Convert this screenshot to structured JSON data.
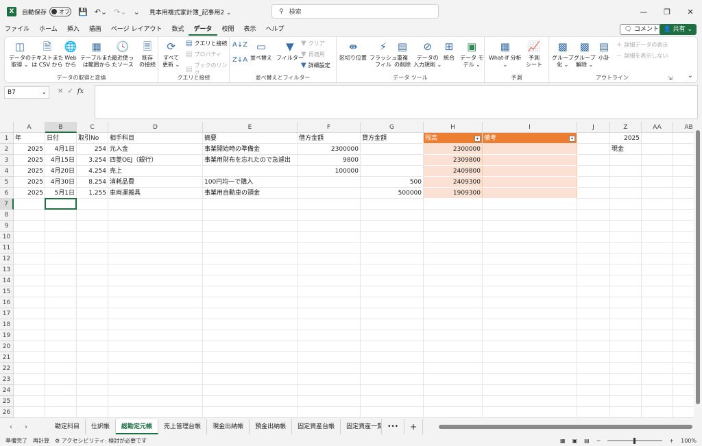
{
  "titlebar": {
    "logo": "X",
    "autosave_label": "自動保存",
    "autosave_state": "オフ",
    "filename": "見本用複式家計簿_記事用2 ⌄",
    "search_placeholder": "検索"
  },
  "menu": {
    "tabs": [
      "ファイル",
      "ホーム",
      "挿入",
      "描画",
      "ページ レイアウト",
      "数式",
      "データ",
      "校閲",
      "表示",
      "ヘルプ"
    ],
    "active": "データ",
    "comment_label": "コメント",
    "share_label": "共有"
  },
  "ribbon": {
    "group1": {
      "label": "データの取得と変換",
      "buttons": [
        "データの\n取得 ⌄",
        "テキストまた\nは CSV から",
        "Web\nから",
        "テーブルまた\nは範囲から",
        "最近使っ\nたソース",
        "既存\nの接続"
      ]
    },
    "group2": {
      "label": "クエリと接続",
      "refresh": "すべて\n更新 ⌄",
      "queries": "クエリと接続",
      "properties": "プロパティ",
      "links": "ブックのリンク"
    },
    "group3": {
      "label": "並べ替えとフィルター",
      "sort": "並べ替え",
      "filter": "フィルター",
      "clear": "クリア",
      "reapply": "再適用",
      "advanced": "詳細設定"
    },
    "group4": {
      "label": "データ ツール",
      "buttons": [
        "区切り位置",
        "フラッシュ\nフィル",
        "重複\nの削除",
        "データの\n入力規則 ⌄",
        "統合",
        "データ モ\nデル ⌄"
      ]
    },
    "group5": {
      "label": "予測",
      "buttons": [
        "What-If 分析\n⌄",
        "予測\nシート"
      ]
    },
    "group6": {
      "label": "アウトライン",
      "buttons": [
        "グループ\n化 ⌄",
        "グループ\n解除 ⌄",
        "小計"
      ],
      "show_detail": "詳細データの表示",
      "hide_detail": "詳細を表示しない"
    }
  },
  "formula_bar": {
    "name_box": "B7",
    "fx": "fx",
    "content": ""
  },
  "grid": {
    "columns": [
      "A",
      "B",
      "C",
      "D",
      "E",
      "F",
      "G",
      "H",
      "I",
      "J",
      "Z",
      "AA",
      "AB"
    ],
    "rows": [
      "1",
      "2",
      "3",
      "4",
      "5",
      "6",
      "7",
      "8",
      "9",
      "10",
      "11",
      "12",
      "13",
      "14",
      "15",
      "16",
      "17",
      "18",
      "19",
      "20",
      "21",
      "22",
      "23",
      "24",
      "25",
      "26"
    ],
    "headers": {
      "a": "年",
      "b": "日付",
      "c": "取引No",
      "d": "相手科目",
      "e": "摘要",
      "f": "借方金額",
      "g": "貸方金額",
      "h": "残高",
      "i": "備考",
      "z": "2025"
    },
    "z2": "現金",
    "data": [
      {
        "a": "2025",
        "b": "4月1日",
        "c": "254",
        "d": "元入金",
        "e": "事業開始時の準備金",
        "f": "2300000",
        "g": "",
        "h": "2300000",
        "i": ""
      },
      {
        "a": "2025",
        "b": "4月15日",
        "c": "3.254",
        "d": "四菱OEJ（銀行）",
        "e": "事業用財布を忘れたので急遽出",
        "f": "9800",
        "g": "",
        "h": "2309800",
        "i": ""
      },
      {
        "a": "2025",
        "b": "4月20日",
        "c": "4.254",
        "d": "売上",
        "e": "",
        "f": "100000",
        "g": "",
        "h": "2409800",
        "i": ""
      },
      {
        "a": "2025",
        "b": "4月30日",
        "c": "8.254",
        "d": "消耗品費",
        "e": "100円均一で購入",
        "f": "",
        "g": "500",
        "h": "2409300",
        "i": ""
      },
      {
        "a": "2025",
        "b": "5月1日",
        "c": "1.255",
        "d": "車両運搬具",
        "e": "事業用自動車の頭金",
        "f": "",
        "g": "500000",
        "h": "1909300",
        "i": ""
      }
    ]
  },
  "sheets": {
    "tabs": [
      "勘定科目",
      "仕訳帳",
      "総勘定元帳",
      "売上管理台帳",
      "現金出納帳",
      "預金出納帳",
      "固定資産台帳",
      "固定資産一覧"
    ],
    "active": "総勘定元帳",
    "more": "•••",
    "add": "+"
  },
  "status": {
    "ready": "準備完了",
    "recalc": "再計算",
    "accessibility": "アクセシビリティ: 検討が必要です",
    "zoom": "100%"
  },
  "colors": {
    "excel_green": "#1d6f42",
    "table_header": "#ed7d31",
    "table_body": "#fbe1d3"
  }
}
